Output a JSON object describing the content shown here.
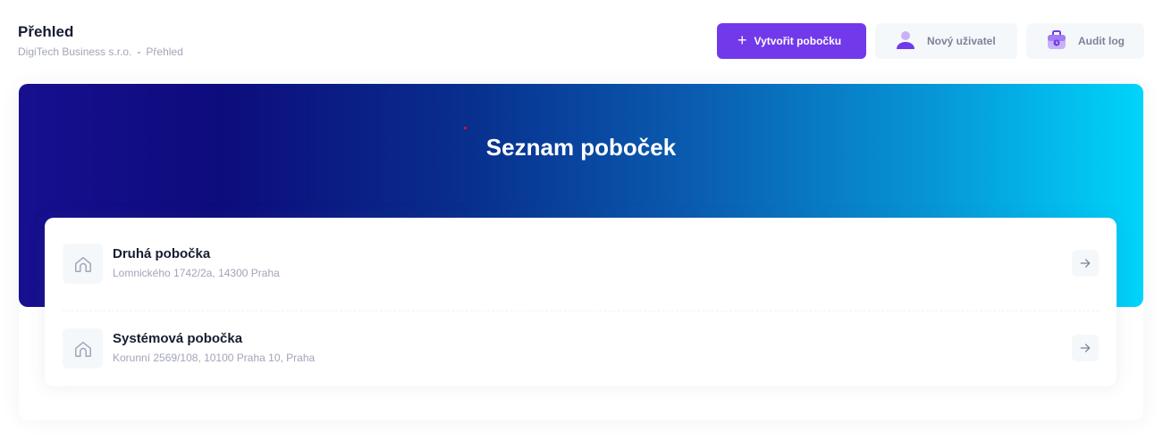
{
  "header": {
    "title": "Přehled",
    "breadcrumb": [
      "DigiTech Business s.r.o.",
      "-",
      "Přehled"
    ]
  },
  "toolbar": {
    "create_branch_label": "Vytvořit pobočku",
    "new_user_label": "Nový uživatel",
    "audit_log_label": "Audit log"
  },
  "hero": {
    "title": "Seznam poboček"
  },
  "branches": [
    {
      "name": "Druhá pobočka",
      "address": "Lomnického 1742/2a, 14300 Praha",
      "icon": "home-icon"
    },
    {
      "name": "Systémová pobočka",
      "address": "Korunní 2569/108, 10100 Praha 10, Praha",
      "icon": "home-icon"
    }
  ],
  "colors": {
    "primary": "#7239ea",
    "hero_start": "#170f8f",
    "hero_end": "#00d4fa"
  }
}
